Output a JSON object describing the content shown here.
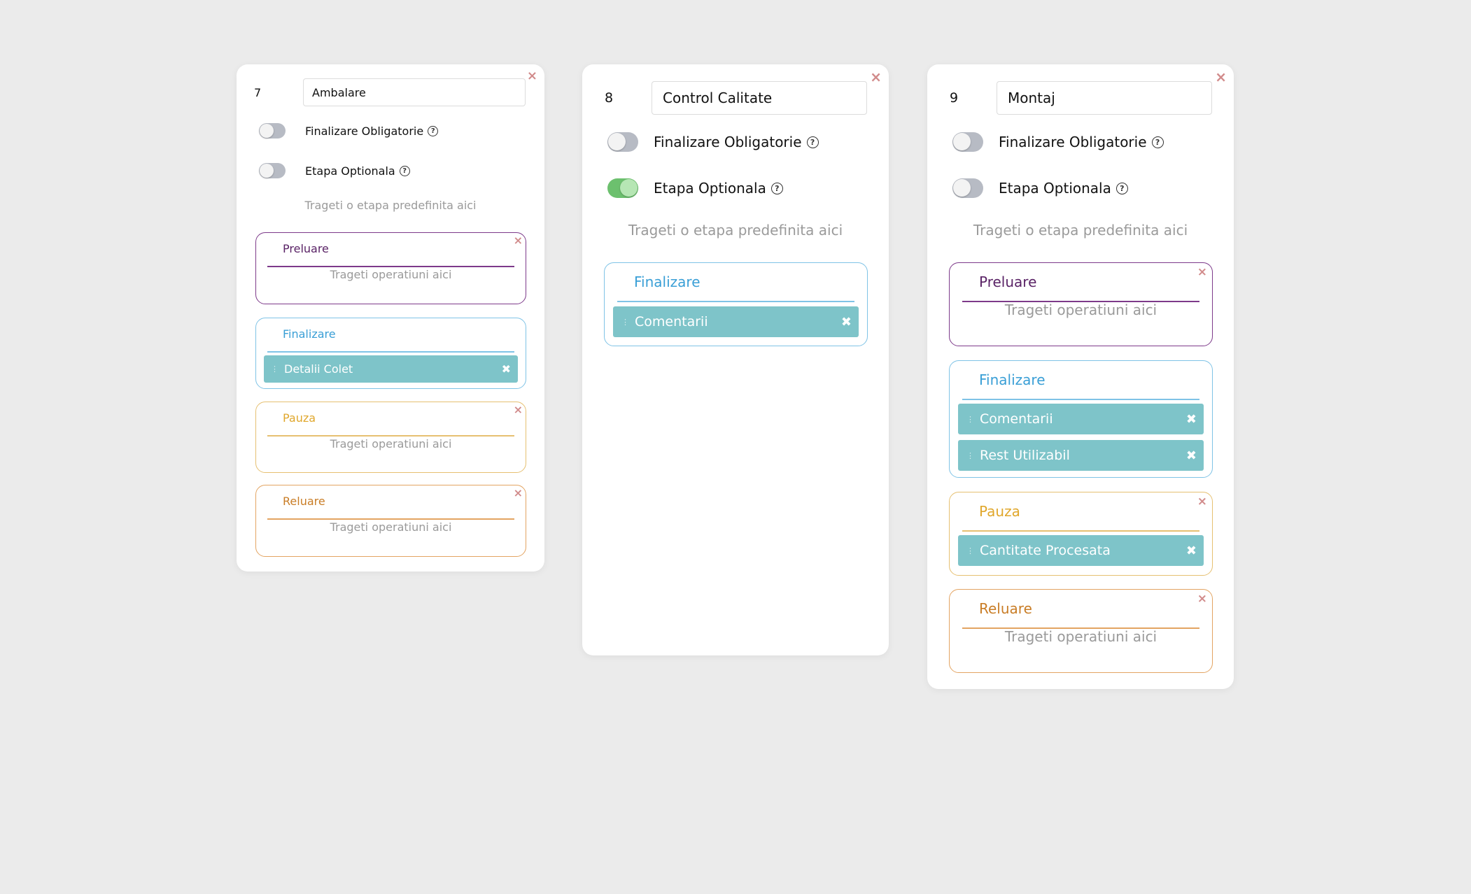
{
  "colors": {
    "background": "#ebebeb",
    "preluare": "#7d3a8a",
    "finalizare": "#3a9fd6",
    "pauza": "#e0b14a",
    "reluare": "#d08a3a",
    "chip": "#7ec4c9",
    "toggle_off": "#b7bbc4",
    "toggle_on": "#6cc06e",
    "close": "#d18b8b"
  },
  "icons": {
    "close": "×",
    "chip_close": "✖",
    "help": "?",
    "grip": "⋮"
  },
  "cards": [
    {
      "number": "7",
      "name": "Ambalare",
      "toggles": [
        {
          "label": "Finalizare Obligatorie",
          "on": false
        },
        {
          "label": "Etapa Optionala",
          "on": false
        }
      ],
      "drop_hint": "Trageti o etapa predefinita aici",
      "phases": [
        {
          "title": "Preluare",
          "hint": "Trageti operatiuni aici",
          "operations": []
        },
        {
          "title": "Finalizare",
          "hint": "",
          "operations": [
            "Detalii Colet"
          ]
        },
        {
          "title": "Pauza",
          "hint": "Trageti operatiuni aici",
          "operations": []
        },
        {
          "title": "Reluare",
          "hint": "Trageti operatiuni aici",
          "operations": []
        }
      ]
    },
    {
      "number": "8",
      "name": "Control Calitate",
      "toggles": [
        {
          "label": "Finalizare Obligatorie",
          "on": false
        },
        {
          "label": "Etapa Optionala",
          "on": true
        }
      ],
      "drop_hint": "Trageti o etapa predefinita aici",
      "phases": [
        {
          "title": "Finalizare",
          "hint": "",
          "operations": [
            "Comentarii"
          ]
        }
      ]
    },
    {
      "number": "9",
      "name": "Montaj",
      "toggles": [
        {
          "label": "Finalizare Obligatorie",
          "on": false
        },
        {
          "label": "Etapa Optionala",
          "on": false
        }
      ],
      "drop_hint": "Trageti o etapa predefinita aici",
      "phases": [
        {
          "title": "Preluare",
          "hint": "Trageti operatiuni aici",
          "operations": []
        },
        {
          "title": "Finalizare",
          "hint": "",
          "operations": [
            "Comentarii",
            "Rest Utilizabil"
          ]
        },
        {
          "title": "Pauza",
          "hint": "",
          "operations": [
            "Cantitate Procesata"
          ]
        },
        {
          "title": "Reluare",
          "hint": "Trageti operatiuni aici",
          "operations": []
        }
      ]
    }
  ]
}
